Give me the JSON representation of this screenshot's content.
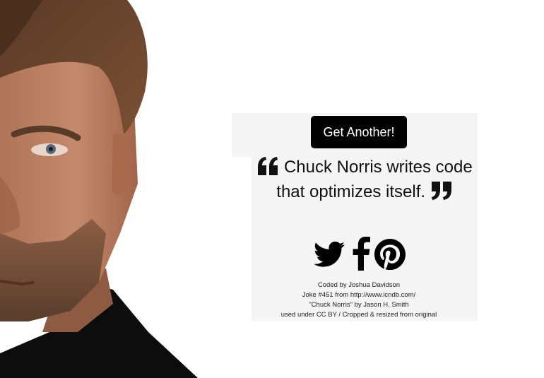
{
  "actions": {
    "get_another_label": "Get Another!"
  },
  "quote": {
    "text": "Chuck Norris writes code that optimizes itself."
  },
  "social": {
    "icons": [
      "twitter-icon",
      "facebook-icon",
      "pinterest-icon"
    ]
  },
  "credits": {
    "line1": "Coded by Joshua Davidson",
    "line2": "Joke #451 from http://www.icndb.com/",
    "line3": "\"Chuck Norris\" by Jason H. Smith",
    "line4": "used under CC BY / Cropped & resized from original"
  },
  "colors": {
    "button_bg": "#000000",
    "button_text": "#ffffff",
    "card_bg": "#f5f5f5",
    "page_bg": "#ffffff"
  }
}
